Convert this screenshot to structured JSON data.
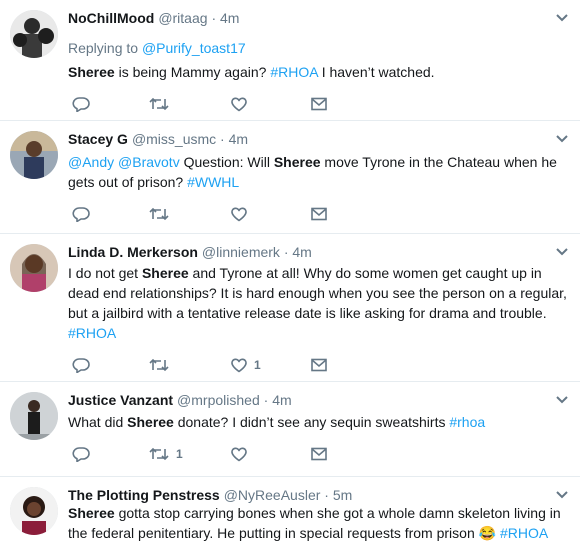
{
  "tweets": [
    {
      "name": "NoChillMood",
      "handle": "@ritaag",
      "sep": "·",
      "time": "4m",
      "reply_prefix": "Replying to ",
      "reply_user": "@Purify_toast17",
      "text": [
        {
          "t": "Sheree",
          "b": true
        },
        {
          "t": " is being Mammy again? "
        },
        {
          "t": "#RHOA",
          "tag": true
        },
        {
          "t": " I haven’t watched."
        }
      ],
      "counts": {
        "reply": "",
        "retweet": "",
        "like": "",
        "dm": ""
      }
    },
    {
      "name": "Stacey G",
      "handle": "@miss_usmc",
      "sep": "·",
      "time": "4m",
      "text": [
        {
          "t": "@Andy",
          "tag": true
        },
        {
          "t": " "
        },
        {
          "t": "@Bravotv",
          "tag": true
        },
        {
          "t": " Question:  Will "
        },
        {
          "t": "Sheree",
          "b": true
        },
        {
          "t": " move Tyrone in the Chateau when he gets out of prison? "
        },
        {
          "t": "#WWHL",
          "tag": true
        }
      ],
      "counts": {
        "reply": "",
        "retweet": "",
        "like": "",
        "dm": ""
      }
    },
    {
      "name": "Linda D. Merkerson",
      "handle": "@linniemerk",
      "sep": "·",
      "time": "4m",
      "text": [
        {
          "t": "I do not get "
        },
        {
          "t": "Sheree",
          "b": true
        },
        {
          "t": " and Tyrone at all! Why do some women get caught up in dead end relationships? It is hard enough when you see the person on a regular, but a jailbird with a tentative release date is like asking for drama and trouble. "
        },
        {
          "t": "#RHOA",
          "tag": true
        }
      ],
      "counts": {
        "reply": "",
        "retweet": "",
        "like": "1",
        "dm": ""
      }
    },
    {
      "name": "Justice Vanzant",
      "handle": "@mrpolished",
      "sep": "·",
      "time": "4m",
      "text": [
        {
          "t": "What did "
        },
        {
          "t": "Sheree",
          "b": true
        },
        {
          "t": " donate? I didn’t see any sequin sweatshirts "
        },
        {
          "t": "#rhoa",
          "tag": true
        }
      ],
      "counts": {
        "reply": "",
        "retweet": "1",
        "like": "",
        "dm": ""
      }
    },
    {
      "name": "The Plotting Penstress",
      "handle": "@NyReeAusler",
      "sep": "·",
      "time": "5m",
      "text": [
        {
          "t": "Sheree",
          "b": true
        },
        {
          "t": " gotta stop carrying bones when she got a whole damn skeleton living in the federal penitentiary. He putting in special requests from prison "
        },
        {
          "t": "😂",
          "emoji": true
        },
        {
          "t": " "
        },
        {
          "t": "#RHOA",
          "tag": true
        }
      ],
      "counts": {
        "reply": "",
        "retweet": "",
        "like": "",
        "dm": ""
      }
    }
  ],
  "icons": {
    "caret": "chevron-down-icon",
    "reply": "reply-icon",
    "retweet": "retweet-icon",
    "like": "heart-icon",
    "dm": "envelope-icon"
  },
  "colors": {
    "link": "#1da1f2",
    "muted": "#657786",
    "text": "#14171a",
    "divider": "#e6ecf0"
  }
}
